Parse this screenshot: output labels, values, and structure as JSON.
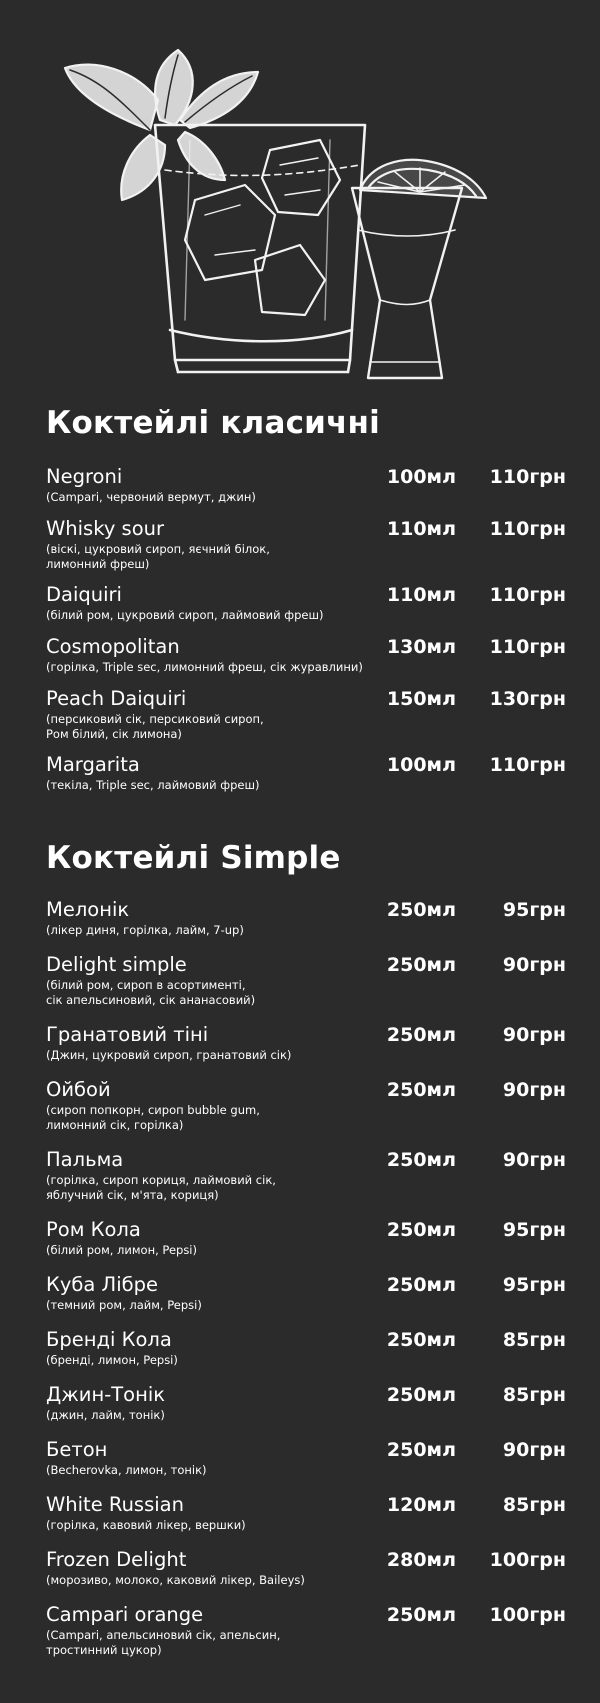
{
  "colors": {
    "background": "#2b2b2c",
    "text": "#ffffff"
  },
  "illustration": {
    "icons": [
      "basil-leaves-icon",
      "rocks-glass-icon",
      "ice-cube-icon",
      "shot-glass-icon",
      "lime-slice-icon"
    ]
  },
  "sections": [
    {
      "title": "Коктейлі класичні",
      "items": [
        {
          "name": "Negroni",
          "desc": "(Campari, червоний вермут, джин)",
          "volume": "100мл",
          "price": "110грн"
        },
        {
          "name": "Whisky sour",
          "desc": "(віскі, цукровий сироп, яєчний білок,\nлимонний фреш)",
          "volume": "110мл",
          "price": "110грн"
        },
        {
          "name": "Daiquiri",
          "desc": "(білий ром, цукровий сироп, лаймовий фреш)",
          "volume": "110мл",
          "price": "110грн"
        },
        {
          "name": "Cosmopolitan",
          "desc": "(горілка, Triple sec, лимонний фреш, сік журавлини)",
          "volume": "130мл",
          "price": "110грн"
        },
        {
          "name": "Peach Daiquiri",
          "desc": "(персиковий сік, персиковий сироп,\nРом білий, сік лимона)",
          "volume": "150мл",
          "price": "130грн"
        },
        {
          "name": "Margarita",
          "desc": "(текіла, Triple sec, лаймовий фреш)",
          "volume": "100мл",
          "price": "110грн"
        }
      ]
    },
    {
      "title": "Коктейлі Simple",
      "items": [
        {
          "name": "Мелонік",
          "desc": "(лікер диня, горілка, лайм, 7-up)",
          "volume": "250мл",
          "price": "95грн"
        },
        {
          "name": "Delight simple",
          "desc": "(білий ром, сироп  в асортименті,\nсік апельсиновий, сік ананасовий)",
          "volume": "250мл",
          "price": "90грн"
        },
        {
          "name": "Гранатовий тіні",
          "desc": "(Джин, цукровий сироп, гранатовий сік)",
          "volume": "250мл",
          "price": "90грн"
        },
        {
          "name": "Ойбой",
          "desc": "(сироп попкорн, сироп bubble gum,\nлимонний сік, горілка)",
          "volume": "250мл",
          "price": "90грн"
        },
        {
          "name": "Пальма",
          "desc": "(горілка, сироп кориця, лаймовий сік,\nяблучний сік, м'ята, кориця)",
          "volume": "250мл",
          "price": "90грн"
        },
        {
          "name": "Ром Кола",
          "desc": "(білий ром, лимон, Pepsi)",
          "volume": "250мл",
          "price": "95грн"
        },
        {
          "name": "Куба Лібре",
          "desc": "(темний ром, лайм, Pepsi)",
          "volume": "250мл",
          "price": "95грн"
        },
        {
          "name": "Бренді Кола",
          "desc": "(бренді, лимон, Pepsi)",
          "volume": "250мл",
          "price": "85грн"
        },
        {
          "name": "Джин-Тонік",
          "desc": "(джин, лайм, тонік)",
          "volume": "250мл",
          "price": "85грн"
        },
        {
          "name": "Бетон",
          "desc": "(Becherovka, лимон, тонік)",
          "volume": "250мл",
          "price": "90грн"
        },
        {
          "name": "White Russian",
          "desc": "(горілка, кавовий лікер, вершки)",
          "volume": "120мл",
          "price": "85грн"
        },
        {
          "name": "Frozen Delight",
          "desc": "(морозиво, молоко, каковий лікер, Baileys)",
          "volume": "280мл",
          "price": "100грн"
        },
        {
          "name": "Campari orange",
          "desc": "(Campari, апельсиновий сік, апельсин,\nтростинний цукор)",
          "volume": "250мл",
          "price": "100грн"
        }
      ]
    }
  ]
}
